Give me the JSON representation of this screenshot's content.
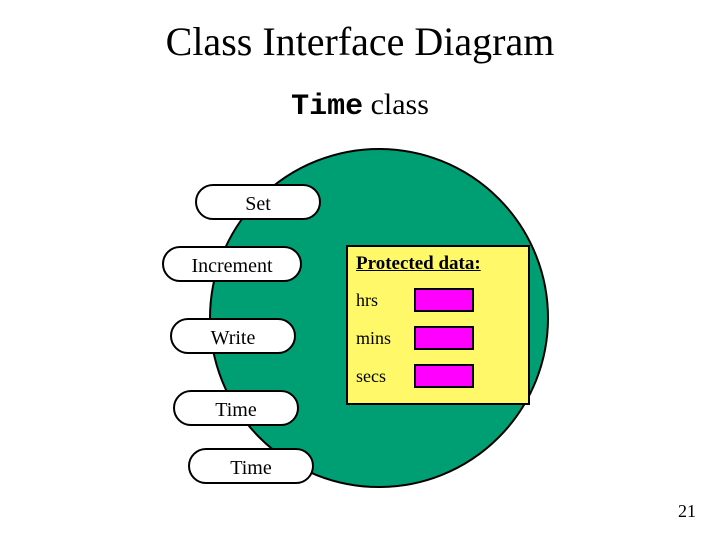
{
  "title": "Class Interface Diagram",
  "subtitle_mono": "Time",
  "subtitle_rest": " class",
  "methods": {
    "set": "Set",
    "increment": "Increment",
    "write": "Write",
    "time1": "Time",
    "time2": "Time"
  },
  "protected": {
    "header": "Protected data:",
    "fields": {
      "hrs": "hrs",
      "mins": "mins",
      "secs": "secs"
    }
  },
  "page_number": "21"
}
